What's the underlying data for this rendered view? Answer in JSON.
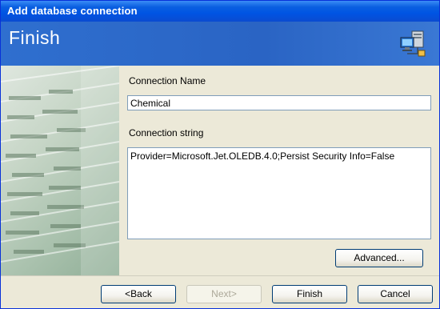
{
  "window": {
    "title": "Add database connection"
  },
  "banner": {
    "title": "Finish",
    "icon": "network-computers-icon"
  },
  "form": {
    "connection_name_label": "Connection Name",
    "connection_name_value": "Chemical",
    "connection_string_label": "Connection string",
    "connection_string_value": "Provider=Microsoft.Jet.OLEDB.4.0;Persist Security Info=False"
  },
  "buttons": {
    "advanced": "Advanced...",
    "back": "<Back",
    "next": "Next>",
    "finish": "Finish",
    "cancel": "Cancel"
  },
  "colors": {
    "titlebar": "#0054e3",
    "banner": "#2f6fcf",
    "dialog_bg": "#ece9d8",
    "button_border": "#003c74"
  }
}
